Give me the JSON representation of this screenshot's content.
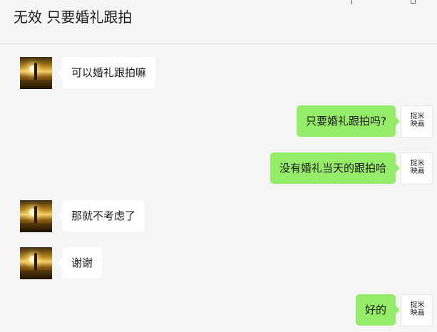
{
  "header": {
    "title": "无效 只要婚礼跟拍"
  },
  "messages": [
    {
      "side": "left",
      "text": "可以婚礼跟拍嘛"
    },
    {
      "side": "right",
      "text": "只要婚礼跟拍吗?"
    },
    {
      "side": "right",
      "text": "没有婚礼当天的跟拍哈"
    },
    {
      "side": "left",
      "text": "那就不考虑了"
    },
    {
      "side": "left",
      "text": "谢谢"
    },
    {
      "side": "right",
      "text": "好的"
    }
  ],
  "self_avatar": {
    "logo_text": "捉米\n映画"
  },
  "colors": {
    "background": "#f5f5f5",
    "incoming_bubble": "#ffffff",
    "outgoing_bubble": "#95ec69",
    "text": "#1a1a1a"
  }
}
